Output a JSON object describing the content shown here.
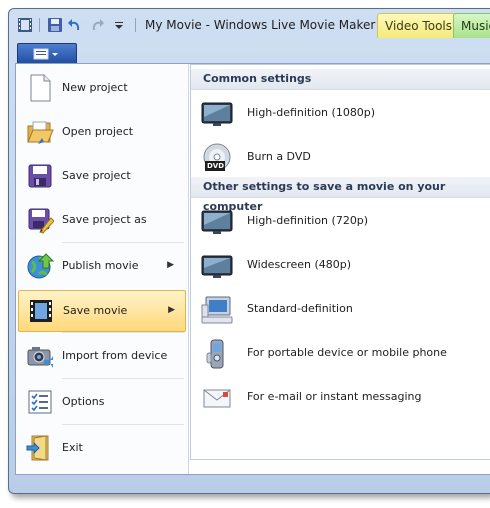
{
  "window": {
    "title": "My Movie - Windows Live Movie Maker",
    "contextual_tabs": [
      "Video Tools",
      "Music"
    ]
  },
  "file_menu": {
    "left_items": [
      {
        "label": "New project",
        "icon": "new-document-icon",
        "has_submenu": false,
        "selected": false
      },
      {
        "label": "Open project",
        "icon": "open-folder-icon",
        "has_submenu": false,
        "selected": false
      },
      {
        "label": "Save project",
        "icon": "floppy-disk-icon",
        "has_submenu": false,
        "selected": false
      },
      {
        "label": "Save project as",
        "icon": "save-as-icon",
        "has_submenu": false,
        "selected": false
      },
      {
        "label": "Publish movie",
        "icon": "globe-upload-icon",
        "has_submenu": true,
        "selected": false
      },
      {
        "label": "Save movie",
        "icon": "film-save-icon",
        "has_submenu": true,
        "selected": true
      },
      {
        "label": "Import from device",
        "icon": "camera-import-icon",
        "has_submenu": false,
        "selected": false
      },
      {
        "label": "Options",
        "icon": "options-checklist-icon",
        "has_submenu": false,
        "selected": false
      },
      {
        "label": "Exit",
        "icon": "exit-door-icon",
        "has_submenu": false,
        "selected": false
      }
    ],
    "submenu": {
      "common_header": "Common settings",
      "common_items": [
        {
          "label": "High-definition (1080p)",
          "icon": "hd-monitor-icon"
        },
        {
          "label": "Burn a DVD",
          "icon": "dvd-disc-icon",
          "badge": "DVD"
        }
      ],
      "other_header": "Other settings to save a movie on your computer",
      "other_items": [
        {
          "label": "High-definition (720p)",
          "icon": "hd-monitor-icon"
        },
        {
          "label": "Widescreen (480p)",
          "icon": "widescreen-monitor-icon"
        },
        {
          "label": "Standard-definition",
          "icon": "computer-monitor-icon"
        },
        {
          "label": "For portable device or mobile phone",
          "icon": "mobile-phone-icon"
        },
        {
          "label": "For e-mail or instant messaging",
          "icon": "email-envelope-icon"
        }
      ]
    }
  }
}
